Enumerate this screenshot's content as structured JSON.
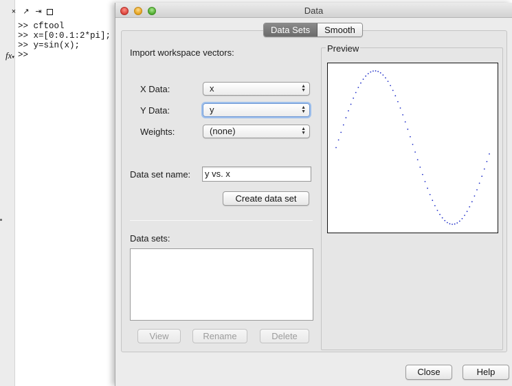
{
  "command_window": {
    "toolbar_icons": [
      "close-icon",
      "undock-icon",
      "tab-icon",
      "maximize-icon"
    ],
    "toolbar_glyphs": [
      "×",
      "↗",
      "⇥",
      ""
    ],
    "lines": [
      ">> cftool",
      ">> x=[0:0.1:2*pi];",
      ">> y=sin(x);"
    ],
    "prompt": ">>",
    "fx_label": "fx"
  },
  "dialog": {
    "title": "Data",
    "tabs": [
      {
        "label": "Data Sets",
        "active": true
      },
      {
        "label": "Smooth",
        "active": false
      }
    ],
    "import_label": "Import workspace vectors:",
    "x_data": {
      "label": "X Data:",
      "value": "x"
    },
    "y_data": {
      "label": "Y Data:",
      "value": "y"
    },
    "weights": {
      "label": "Weights:",
      "value": "(none)"
    },
    "data_set_name": {
      "label": "Data set name:",
      "value": "y vs. x"
    },
    "create_button": "Create data set",
    "data_sets_label": "Data sets:",
    "data_sets": [],
    "view_button": "View",
    "rename_button": "Rename",
    "delete_button": "Delete",
    "preview_label": "Preview",
    "close_button": "Close",
    "help_button": "Help"
  },
  "chart_data": {
    "type": "scatter",
    "series": [
      {
        "expression": "y = sin(x)",
        "x_start": 0,
        "x_step": 0.1,
        "x_end": 6.2,
        "color": "#1f2ec8"
      }
    ],
    "xlim": [
      0,
      6.2
    ],
    "ylim": [
      -1,
      1
    ],
    "grid": false,
    "title": "",
    "xlabel": "",
    "ylabel": ""
  }
}
